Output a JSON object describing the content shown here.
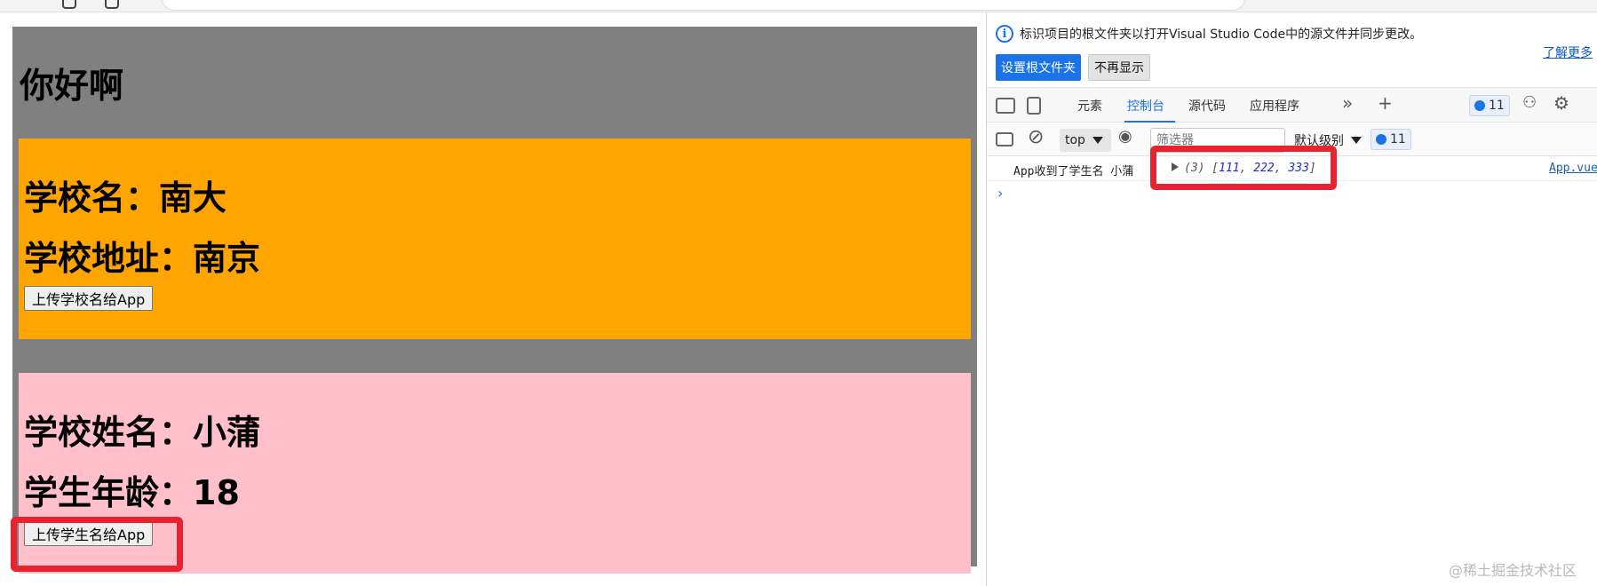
{
  "page": {
    "title": "你好啊",
    "school": {
      "name_line": "学校名：南大",
      "address_line": "学校地址：南京",
      "button_label": "上传学校名给App"
    },
    "student": {
      "name_line": "学校姓名：小蒲",
      "age_line": "学生年龄：18",
      "button_label": "上传学生名给App"
    }
  },
  "devtools": {
    "info_text": "标识项目的根文件夹以打开Visual Studio Code中的源文件并同步更改。",
    "learn_more": "了解更多",
    "set_root_button": "设置根文件夹",
    "dont_show_button": "不再显示",
    "tabs": [
      "元素",
      "控制台",
      "源代码",
      "应用程序"
    ],
    "active_tab": "控制台",
    "issue_count": "11",
    "context": "top",
    "filter_placeholder": "筛选器",
    "level": "默认级别",
    "toolbar_count": "11",
    "log": {
      "text": "App收到了学生名 小蒲",
      "array_count": "(3)",
      "array_values": [
        "111",
        "222",
        "333"
      ],
      "source": "App.vue"
    }
  },
  "watermark": "@稀土掘金技术社区",
  "colors": {
    "app_bg": "#808080",
    "school_bg": "#ffa500",
    "student_bg": "#ffc0cb",
    "highlight": "#e8232f",
    "accent": "#1a73e8"
  },
  "icons": [
    "info-icon",
    "inspect-icon",
    "device-toggle-icon",
    "more-tabs-icon",
    "add-tab-icon",
    "issues-icon",
    "customize-icon",
    "settings-icon",
    "sidebar-toggle-icon",
    "clear-console-icon",
    "live-expression-eye-icon",
    "expand-triangle-icon",
    "prompt-chevron-icon"
  ]
}
